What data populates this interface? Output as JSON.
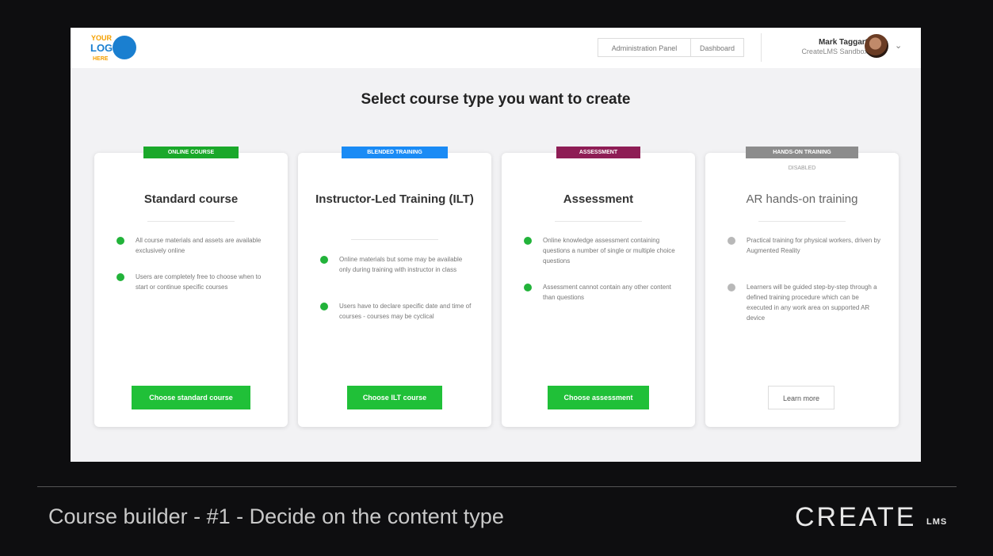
{
  "topbar": {
    "logo_text": "YOUR LOGO HERE",
    "nav": [
      "Administration Panel",
      "Dashboard"
    ],
    "user_name": "Mark Taggart",
    "user_org": "CreateLMS Sandbox"
  },
  "headline": "Select course type you want to create",
  "cards": [
    {
      "badge": "ONLINE COURSE",
      "badge_color": "#1aa82a",
      "title": "Standard course",
      "bullets": [
        "All course materials and assets are available exclusively online",
        "Users are completely free to choose when to start or continue specific courses"
      ],
      "button": "Choose standard course"
    },
    {
      "badge": "BLENDED TRAINING",
      "badge_color": "#1a8bf5",
      "title": "Instructor-Led Training (ILT)",
      "bullets": [
        "Online materials but some may be available only during training with instructor in class",
        "Users have to declare specific date and time of courses - courses may be cyclical"
      ],
      "button": "Choose ILT course"
    },
    {
      "badge": "ASSESSMENT",
      "badge_color": "#8e1d55",
      "title": "Assessment",
      "bullets": [
        "Online knowledge assessment containing questions a number of single or multiple choice questions",
        "Assessment cannot contain any other content than questions"
      ],
      "button": "Choose assessment"
    },
    {
      "badge": "HANDS-ON TRAINING",
      "badge_color": "#8c8c8c",
      "status": "DISABLED",
      "title": "AR hands-on training",
      "bullets": [
        "Practical training for physical workers, driven by Augmented Reality",
        "Learners will be guided step-by-step through a defined training procedure which can be executed in any work area on supported AR device"
      ],
      "button": "Learn more"
    }
  ],
  "footer": {
    "caption": "Course builder - #1 - Decide on the content type",
    "brand": "CREATE",
    "brand_sub": "LMS"
  }
}
